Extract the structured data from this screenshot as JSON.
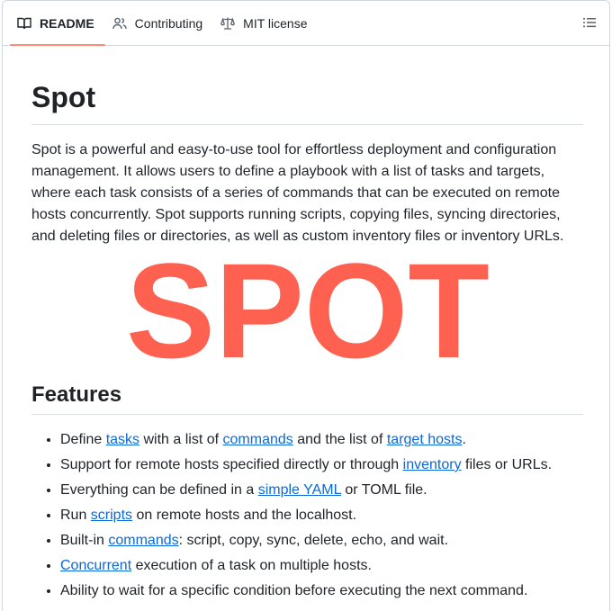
{
  "tabs": [
    {
      "label": "README",
      "icon": "book-icon",
      "active": true
    },
    {
      "label": "Contributing",
      "icon": "people-icon",
      "active": false
    },
    {
      "label": "MIT license",
      "icon": "law-scale-icon",
      "active": false
    }
  ],
  "outline_icon": "list-unordered-icon",
  "readme": {
    "title": "Spot",
    "intro": "Spot is a powerful and easy-to-use tool for effortless deployment and configuration management. It allows users to define a playbook with a list of tasks and targets, where each task consists of a series of commands that can be executed on remote hosts concurrently. Spot supports running scripts, copying files, syncing directories, and deleting files or directories, as well as custom inventory files or inventory URLs.",
    "logo": {
      "text": "SPOT",
      "color": "#ff6150"
    },
    "features_title": "Features",
    "features": [
      [
        {
          "t": "Define "
        },
        {
          "t": "tasks",
          "link": true
        },
        {
          "t": " with a list of "
        },
        {
          "t": "commands",
          "link": true
        },
        {
          "t": " and the list of "
        },
        {
          "t": "target hosts",
          "link": true
        },
        {
          "t": "."
        }
      ],
      [
        {
          "t": "Support for remote hosts specified directly or through "
        },
        {
          "t": "inventory",
          "link": true
        },
        {
          "t": " files or URLs."
        }
      ],
      [
        {
          "t": "Everything can be defined in a "
        },
        {
          "t": "simple YAML",
          "link": true
        },
        {
          "t": " or TOML file."
        }
      ],
      [
        {
          "t": "Run "
        },
        {
          "t": "scripts",
          "link": true
        },
        {
          "t": " on remote hosts and the localhost."
        }
      ],
      [
        {
          "t": "Built-in "
        },
        {
          "t": "commands",
          "link": true
        },
        {
          "t": ": script, copy, sync, delete, echo, and wait."
        }
      ],
      [
        {
          "t": "Concurrent",
          "link": true
        },
        {
          "t": " execution of a task on multiple hosts."
        }
      ],
      [
        {
          "t": "Ability to wait for a specific condition before executing the next command."
        }
      ]
    ]
  },
  "colors": {
    "link": "#0969da",
    "tab_underline": "#fd8c73",
    "text": "#1f2328"
  }
}
